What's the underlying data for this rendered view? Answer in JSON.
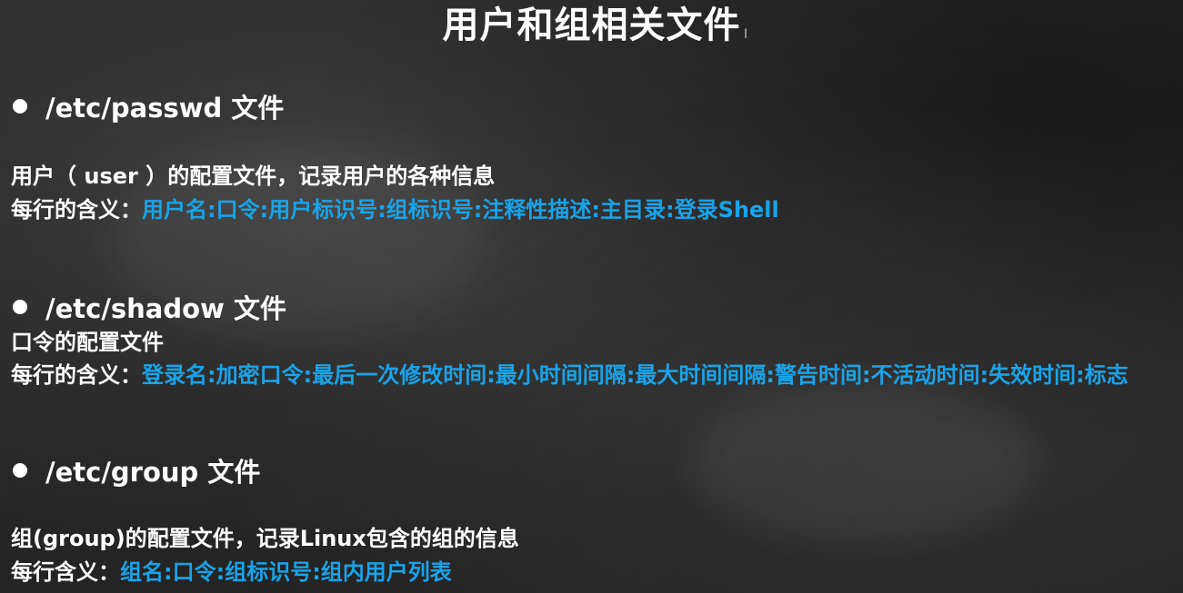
{
  "title": "用户和组相关文件",
  "cursor_glyph": "I",
  "sections": [
    {
      "heading": "/etc/passwd 文件",
      "description": "用户（ user ）的配置文件，记录用户的各种信息",
      "meaning_label": "每行的含义：",
      "meaning_value": "用户名:口令:用户标识号:组标识号:注释性描述:主目录:登录Shell"
    },
    {
      "heading": "/etc/shadow 文件",
      "description": "口令的配置文件",
      "meaning_label": "每行的含义：",
      "meaning_value": "登录名:加密口令:最后一次修改时间:最小时间间隔:最大时间间隔:警告时间:不活动时间:失效时间:标志"
    },
    {
      "heading": "/etc/group 文件",
      "description": "组(group)的配置文件，记录Linux包含的组的信息",
      "meaning_label": "每行含义：",
      "meaning_value": "组名:口令:组标识号:组内用户列表"
    }
  ],
  "colors": {
    "text": "#ffffff",
    "highlight": "#1aa3e8",
    "background": "#262626"
  }
}
